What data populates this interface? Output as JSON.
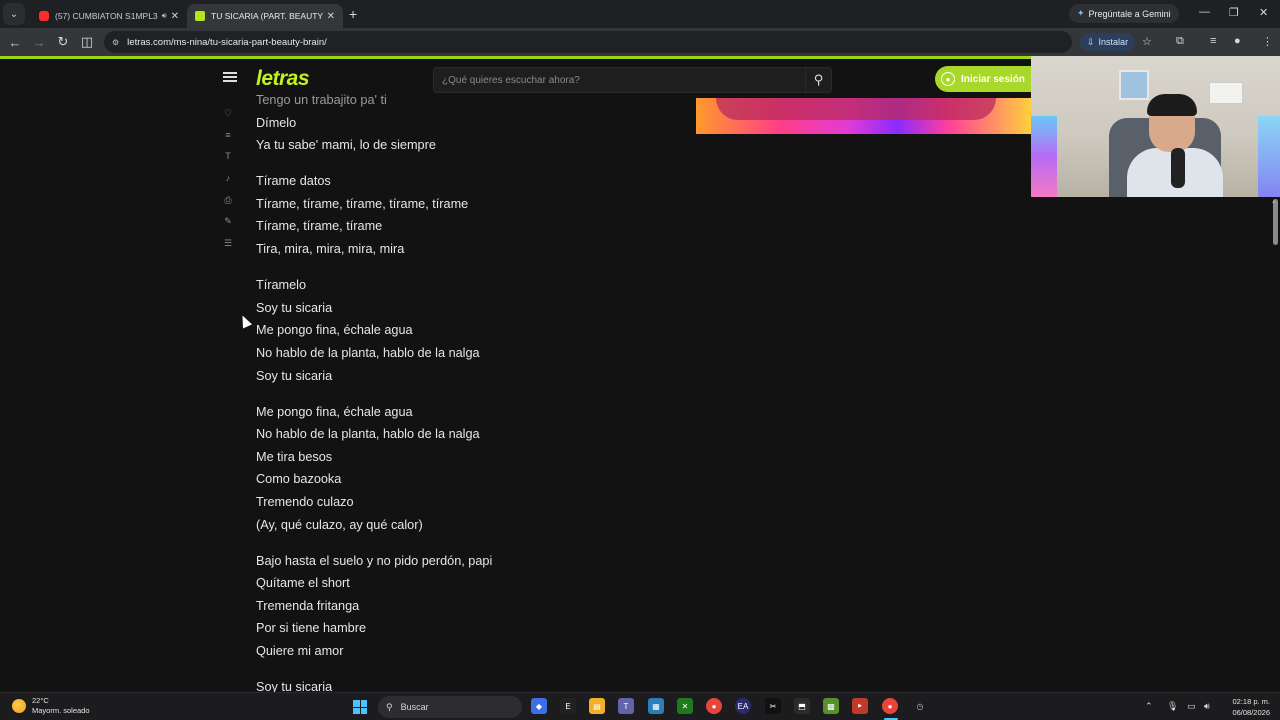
{
  "browser": {
    "tabs": [
      {
        "title": "(57) CUMBIATON S1MPL3",
        "active": false,
        "favicon": "youtube-icon",
        "audio": true
      },
      {
        "title": "TU SICARIA (PART. BEAUTY BRAIN)",
        "active": true,
        "favicon": "letras-icon",
        "audio": false
      }
    ],
    "gemini_label": "Pregúntale a Gemini",
    "url": "letras.com/ms-nina/tu-sicaria-part-beauty-brain/",
    "install_label": "Instalar"
  },
  "site": {
    "logo": "letras",
    "search_placeholder": "¿Qué quieres escuchar ahora?",
    "login_label": "Iniciar sesión",
    "accent_color": "#a8d82a"
  },
  "lyrics": {
    "stanzas": [
      [
        "Tengo un trabajito pa' ti",
        "Dímelo",
        "Ya tu sabe' mami, lo de siempre"
      ],
      [
        "Tírame datos",
        "Tírame, tírame, tírame, tírame, tírame",
        "Tírame, tírame, tírame",
        "Tira, mira, mira, mira, mira"
      ],
      [
        "Tíramelo",
        "Soy tu sicaria",
        "Me pongo fina, échale agua",
        "No hablo de la planta, hablo de la nalga",
        "Soy tu sicaria"
      ],
      [
        "Me pongo fina, échale agua",
        "No hablo de la planta, hablo de la nalga",
        "Me tira besos",
        "Como bazooka",
        "Tremendo culazo",
        "(Ay, qué culazo, ay qué calor)"
      ],
      [
        "Bajo hasta el suelo y no pido perdón, papi",
        "Quítame el short",
        "Tremenda fritanga",
        "Por si tiene hambre",
        "Quiere mi amor"
      ],
      [
        "Soy tu sicaria"
      ]
    ]
  },
  "taskbar": {
    "weather_temp": "22°C",
    "weather_desc": "Mayorm. soleado",
    "search_label": "Buscar",
    "time": "02:18 p. m.",
    "date": "06/08/2026"
  }
}
